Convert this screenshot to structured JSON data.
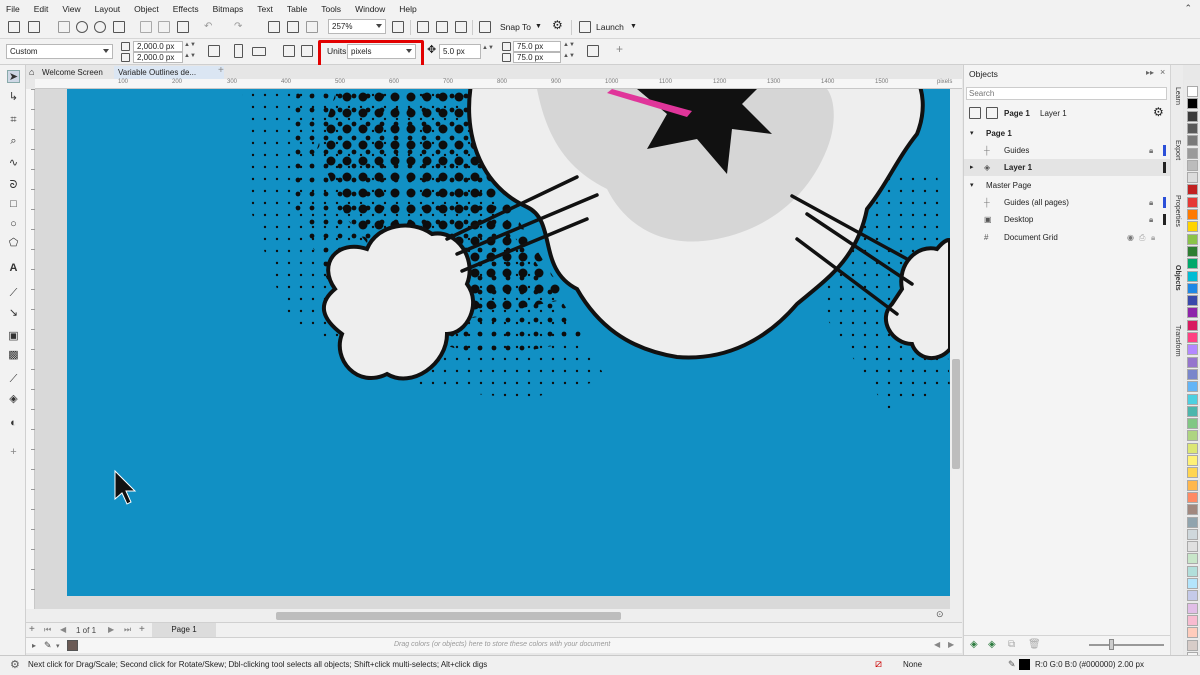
{
  "menubar": {
    "items": [
      "File",
      "Edit",
      "View",
      "Layout",
      "Object",
      "Effects",
      "Bitmaps",
      "Text",
      "Table",
      "Tools",
      "Window",
      "Help"
    ]
  },
  "toolbar": {
    "zoom": "257%",
    "snap_label": "Snap To",
    "launch_label": "Launch"
  },
  "propbar": {
    "preset": "Custom",
    "width": "2,000.0 px",
    "height": "2,000.0 px",
    "units_label": "Units:",
    "units_value": "pixels",
    "nudge": "5.0 px",
    "dup_x": "75.0 px",
    "dup_y": "75.0 px"
  },
  "tabs": {
    "welcome": "Welcome Screen",
    "document": "Variable Outlines de..."
  },
  "ruler": {
    "h_ticks": [
      "100",
      "200",
      "300",
      "400",
      "500",
      "600",
      "700",
      "800",
      "900",
      "1000",
      "1100",
      "1200",
      "1300",
      "1400",
      "1500",
      "1600"
    ],
    "unit": "pixels"
  },
  "page_nav": {
    "counter": "1 of 1",
    "page_tab": "Page 1"
  },
  "colorwell": {
    "hint": "Drag colors (or objects) here to store these colors with your document"
  },
  "objects_panel": {
    "title": "Objects",
    "search_placeholder": "Search",
    "page_label": "Page 1",
    "layer_label": "Layer 1",
    "rows": [
      {
        "label": "Page 1",
        "bold": true
      },
      {
        "label": "Guides"
      },
      {
        "label": "Layer 1",
        "bold": true
      },
      {
        "label": "Master Page"
      },
      {
        "label": "Guides (all pages)"
      },
      {
        "label": "Desktop"
      },
      {
        "label": "Document Grid"
      }
    ]
  },
  "side_tabs": [
    "Learn",
    "Export",
    "Properties",
    "Objects",
    "Transform"
  ],
  "status": {
    "hint": "Next click for Drag/Scale; Second click for Rotate/Skew; Dbl-clicking tool selects all objects; Shift+click multi-selects; Alt+click digs",
    "fill": "None",
    "outline": "R:0 G:0 B:0 (#000000)  2.00 px"
  },
  "colors": {
    "canvas_blue": "#1190c4",
    "highlight_red": "#e20000",
    "cloud": "#eeeeee"
  },
  "palette": [
    "#ffffff",
    "#000000",
    "#3a3a3a",
    "#595959",
    "#7a7a7a",
    "#9a9a9a",
    "#bcbcbc",
    "#dcdcdc",
    "#c02020",
    "#e53935",
    "#ff7a00",
    "#ffd400",
    "#8bc34a",
    "#2e7d32",
    "#00a86b",
    "#00bcd4",
    "#1e88e5",
    "#3949ab",
    "#8e24aa",
    "#d81b60",
    "#ff4081",
    "#b388ff",
    "#9575cd",
    "#7986cb",
    "#64b5f6",
    "#4dd0e1",
    "#4db6ac",
    "#81c784",
    "#aed581",
    "#dce775",
    "#fff176",
    "#ffd54f",
    "#ffb74d",
    "#ff8a65",
    "#a1887f",
    "#90a4ae",
    "#cfd8dc",
    "#e0e0e0",
    "#c8e6c9",
    "#b2dfdb",
    "#b3e5fc",
    "#c5cae9",
    "#e1bee7",
    "#f8bbd0",
    "#ffccbc",
    "#d7ccc8",
    "#f5f5f5"
  ]
}
